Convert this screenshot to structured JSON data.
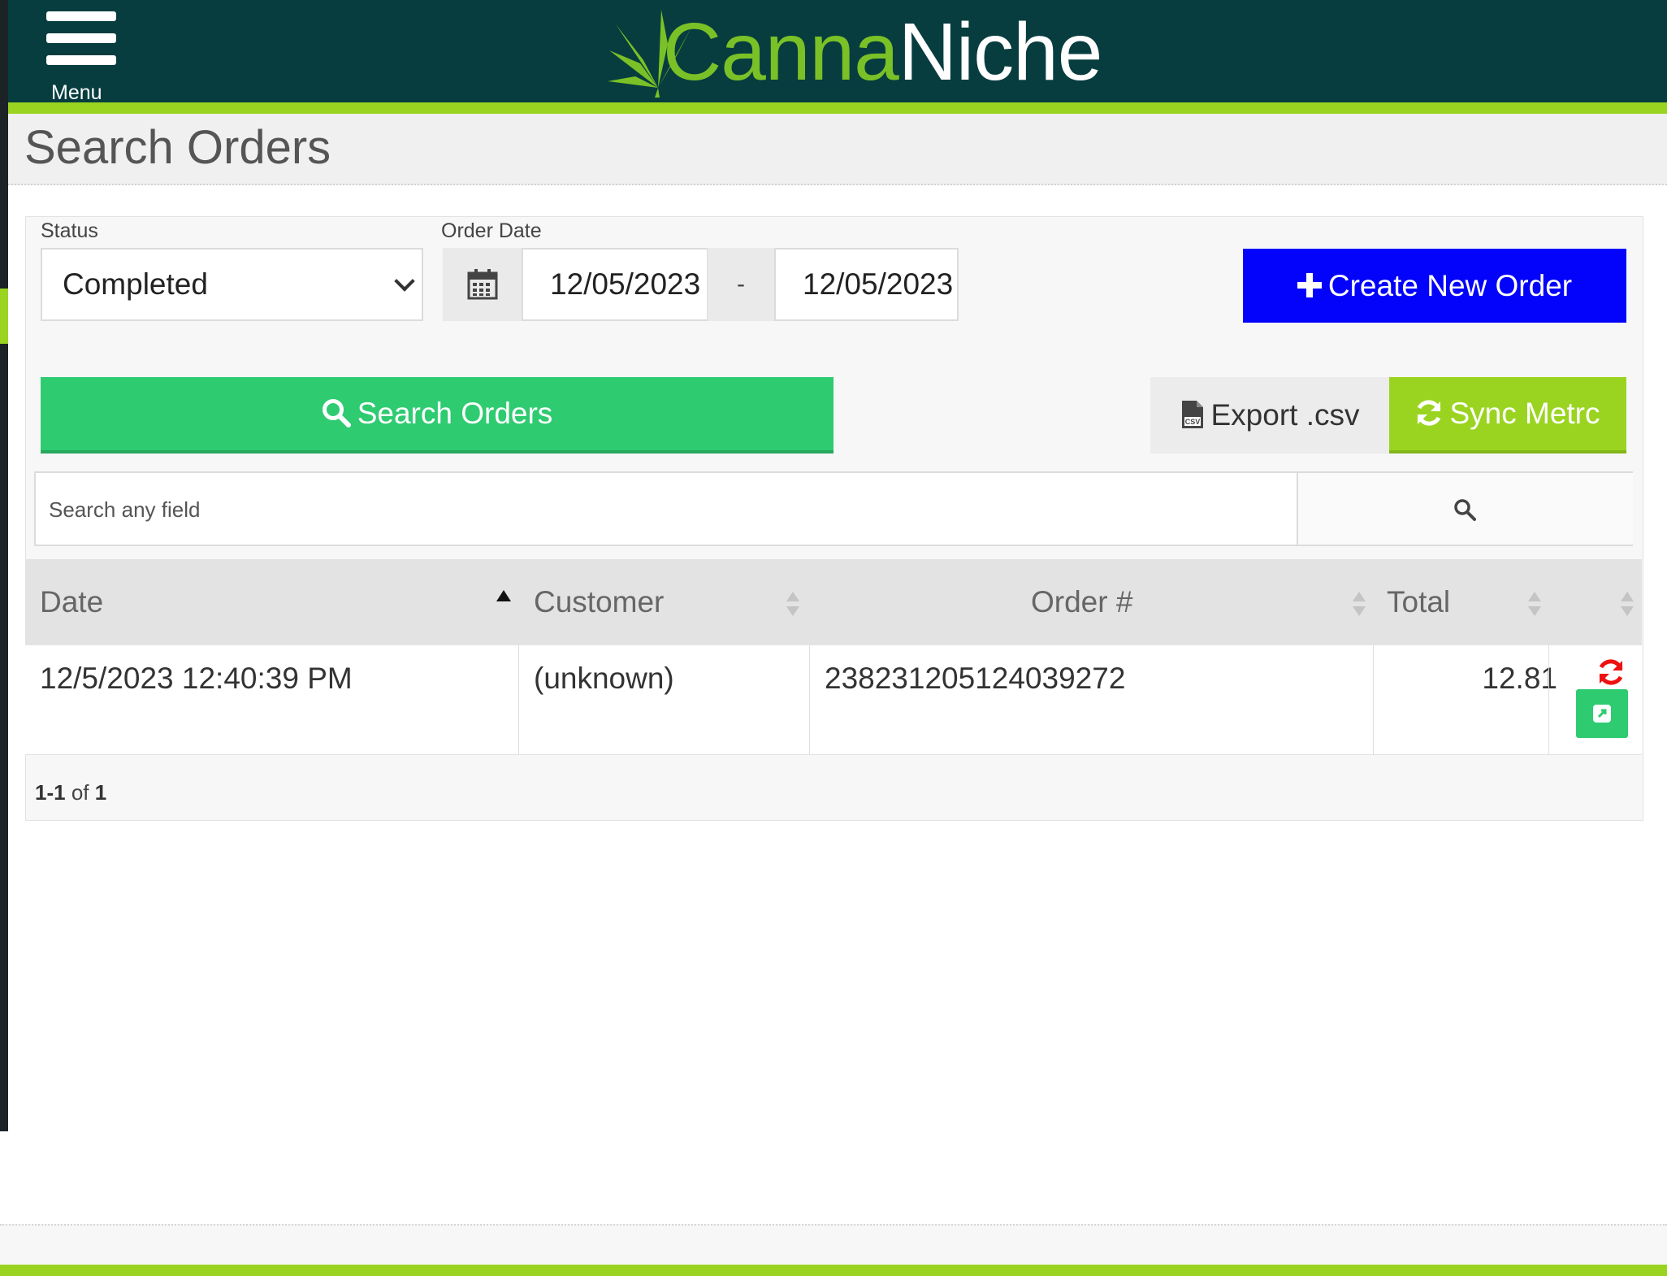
{
  "header": {
    "menu_label": "Menu",
    "brand_part1": "Canna",
    "brand_part2": "Niche",
    "brand_color": "#7ac127",
    "bar_color": "#073d3f",
    "accent_color": "#9ad421"
  },
  "page": {
    "title": "Search Orders"
  },
  "filters": {
    "status_label": "Status",
    "status_value": "Completed",
    "order_date_label": "Order Date",
    "date_from": "12/05/2023",
    "date_separator": "-",
    "date_to": "12/05/2023",
    "calendar_icon": "calendar-icon"
  },
  "buttons": {
    "create_new_order": "Create New Order",
    "search_orders": "Search Orders",
    "export_csv": "Export .csv",
    "sync_metrc": "Sync Metrc",
    "create_color": "#0303fb",
    "search_color": "#2ecb71"
  },
  "search": {
    "placeholder": "Search any field"
  },
  "table": {
    "columns": [
      "Date",
      "Customer",
      "Order #",
      "Total"
    ],
    "sort_column": "Date",
    "sort_direction": "ascending",
    "rows": [
      {
        "date": "12/5/2023 12:40:39 PM",
        "customer": "(unknown)",
        "order_number": "238231205124039272",
        "total": "12.81"
      }
    ]
  },
  "pagination": {
    "range": "1-1",
    "of_label": "of",
    "total": "1"
  }
}
